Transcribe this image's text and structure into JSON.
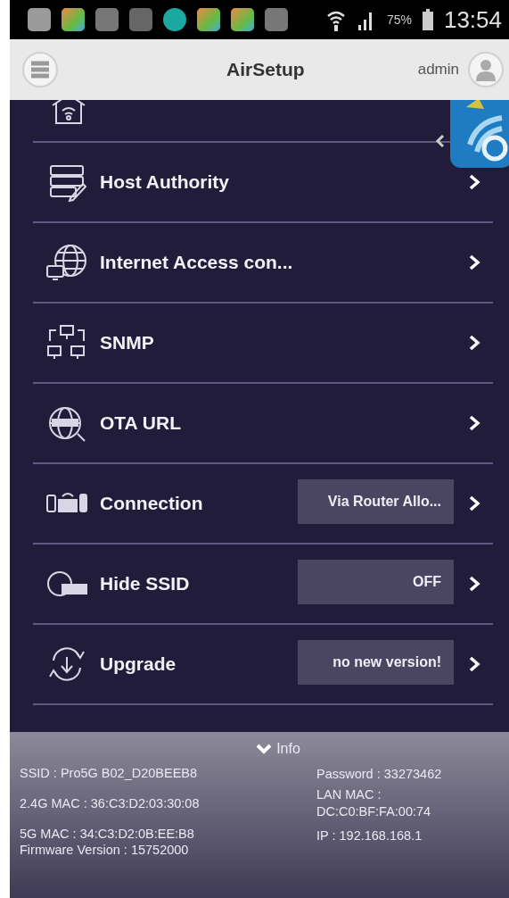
{
  "status_bar": {
    "battery": "75%",
    "time": "13:54"
  },
  "app_bar": {
    "title": "AirSetup",
    "user": "admin"
  },
  "menu": [
    {
      "label": "Host Authority"
    },
    {
      "label": "Internet Access con..."
    },
    {
      "label": "SNMP"
    },
    {
      "label": "OTA URL"
    },
    {
      "label": "Connection",
      "value": "Via Router Allo..."
    },
    {
      "label": "Hide SSID",
      "value": "OFF"
    },
    {
      "label": "Upgrade",
      "value": "no new version!"
    }
  ],
  "info": {
    "toggle": "Info",
    "left": [
      "SSID : Pro5G B02_D20BEEB8",
      "2.4G MAC : 36:C3:D2:03:30:08",
      "5G MAC : 34:C3:D2:0B:EE:B8",
      "Firmware Version : 15752000"
    ],
    "right": [
      "Password : 33273462",
      "LAN MAC : DC:C0:BF:FA:00:74",
      "IP : 192.168.168.1"
    ]
  }
}
